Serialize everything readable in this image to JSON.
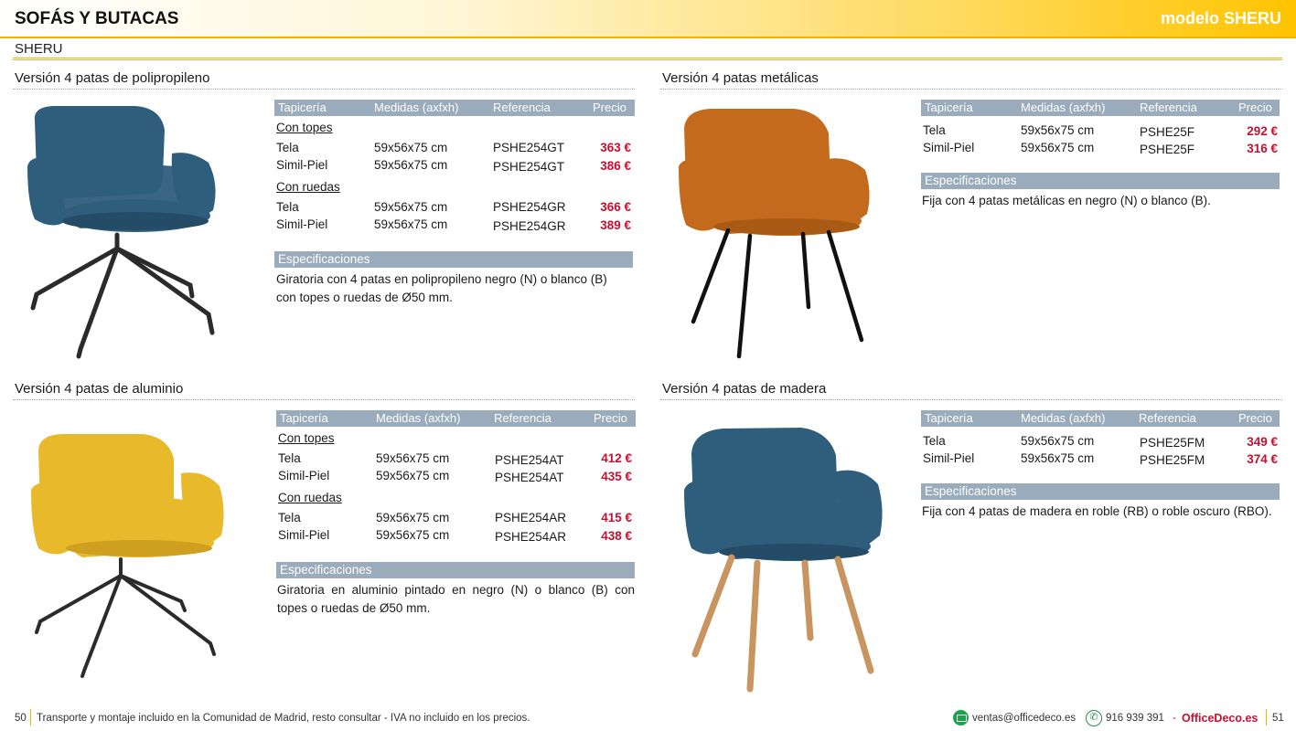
{
  "header": {
    "title": "SOFÁS Y BUTACAS",
    "model": "modelo SHERU"
  },
  "subtitle": "SHERU",
  "table_headers": {
    "upholstery": "Tapicería",
    "sizes": "Medidas (axfxh)",
    "reference": "Referencia",
    "price": "Precio"
  },
  "spec_header": "Especificaciones",
  "colors": {
    "accent_yellow": "#ffc400",
    "header_gray": "#9aabbb",
    "price_red": "#c8102e"
  },
  "sections": {
    "polypropylene": {
      "title": "Versión 4 patas de polipropileno",
      "chair_color": "#2f5e7c",
      "group_topes": "Con topes",
      "group_ruedas": "Con ruedas",
      "rows": [
        {
          "upholstery": "Tela",
          "size": "59x56x75 cm",
          "ref": "PSHE254GT",
          "price": "363 €"
        },
        {
          "upholstery": "Simil-Piel",
          "size": "59x56x75 cm",
          "ref": "PSHE254GT",
          "price": "386 €"
        },
        {
          "upholstery": "Tela",
          "size": "59x56x75 cm",
          "ref": "PSHE254GR",
          "price": "366 €"
        },
        {
          "upholstery": "Simil-Piel",
          "size": "59x56x75 cm",
          "ref": "PSHE254GR",
          "price": "389 €"
        }
      ],
      "spec_line1": "Giratoria con 4 patas en polipropileno negro (N) o blanco (B)",
      "spec_line2": "con topes o ruedas de Ø50 mm."
    },
    "metal": {
      "title": "Versión 4 patas metálicas",
      "chair_color": "#c46a1c",
      "rows": [
        {
          "upholstery": "Tela",
          "size": "59x56x75 cm",
          "ref": "PSHE25F",
          "price": "292 €"
        },
        {
          "upholstery": "Simil-Piel",
          "size": "59x56x75 cm",
          "ref": "PSHE25F",
          "price": "316 €"
        }
      ],
      "spec_line1": "Fija con 4 patas metálicas en negro (N) o blanco (B)."
    },
    "aluminium": {
      "title": "Versión 4 patas de aluminio",
      "chair_color": "#e8b92a",
      "group_topes": "Con topes",
      "group_ruedas": "Con ruedas",
      "rows": [
        {
          "upholstery": "Tela",
          "size": "59x56x75 cm",
          "ref": "PSHE254AT",
          "price": "412 €"
        },
        {
          "upholstery": "Simil-Piel",
          "size": "59x56x75 cm",
          "ref": "PSHE254AT",
          "price": "435 €"
        },
        {
          "upholstery": "Tela",
          "size": "59x56x75 cm",
          "ref": "PSHE254AR",
          "price": "415 €"
        },
        {
          "upholstery": "Simil-Piel",
          "size": "59x56x75 cm",
          "ref": "PSHE254AR",
          "price": "438 €"
        }
      ],
      "spec_line1": "Giratoria en aluminio pintado en negro (N) o blanco (B) con",
      "spec_line2": "topes o ruedas de Ø50 mm."
    },
    "wood": {
      "title": "Versión 4 patas de madera",
      "chair_color": "#2f5e7c",
      "rows": [
        {
          "upholstery": "Tela",
          "size": "59x56x75 cm",
          "ref": "PSHE25FM",
          "price": "349 €"
        },
        {
          "upholstery": "Simil-Piel",
          "size": "59x56x75 cm",
          "ref": "PSHE25FM",
          "price": "374 €"
        }
      ],
      "spec_line1": "Fija con 4 patas de madera en roble (RB) o roble oscuro (RBO)."
    }
  },
  "footer": {
    "page_left": "50",
    "note": "Transporte y montaje incluido en la Comunidad de Madrid, resto consultar - IVA no incluido en los precios.",
    "email": "ventas@officedeco.es",
    "phone": "916 939 391",
    "dash": "-",
    "brand": "OfficeDeco.es",
    "page_right": "51"
  }
}
